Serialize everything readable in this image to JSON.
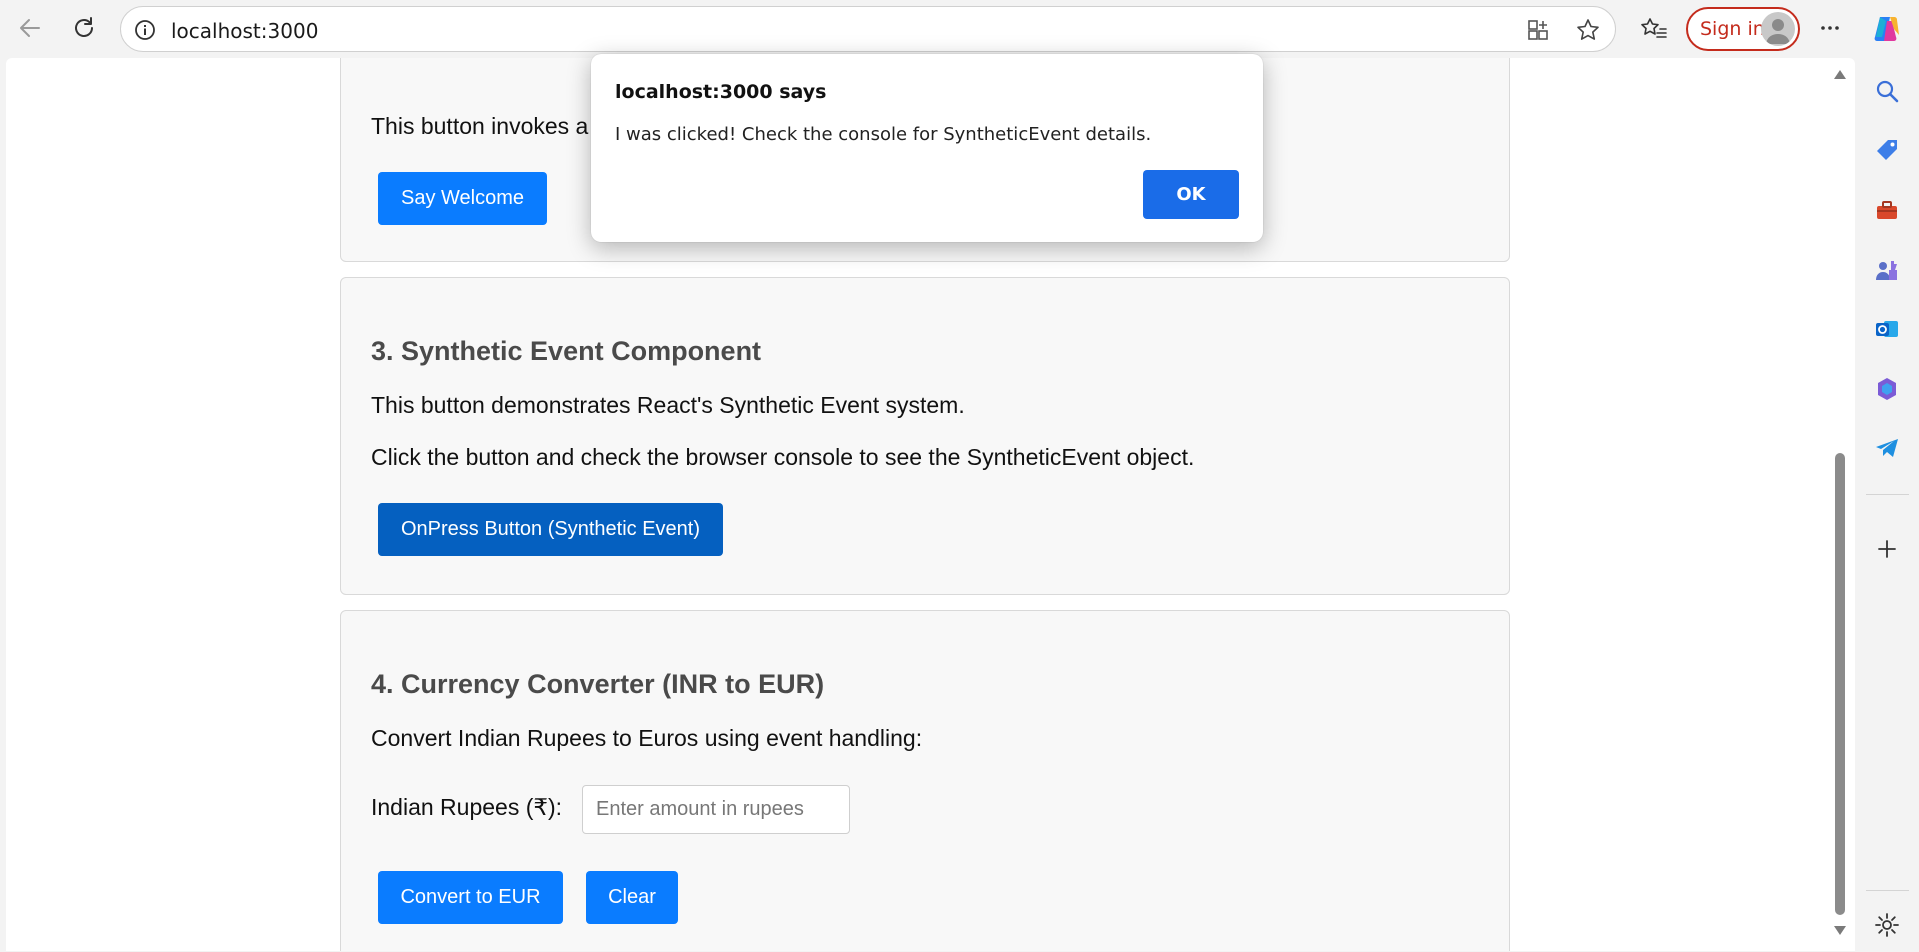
{
  "browser": {
    "url": "localhost:3000",
    "signin_label": "Sign in",
    "accent_color": "#c42b1c"
  },
  "page": {
    "card1": {
      "text": "This button invokes a",
      "button_label": "Say Welcome"
    },
    "card2": {
      "title": "3. Synthetic Event Component",
      "text1": "This button demonstrates React's Synthetic Event system.",
      "text2": "Click the button and check the browser console to see the SyntheticEvent object.",
      "button_label": "OnPress Button (Synthetic Event)"
    },
    "card3": {
      "title": "4. Currency Converter (INR to EUR)",
      "text": "Convert Indian Rupees to Euros using event handling:",
      "input_label": "Indian Rupees (₹):",
      "input_placeholder": "Enter amount in rupees",
      "input_value": "",
      "convert_label": "Convert to EUR",
      "clear_label": "Clear"
    },
    "button_color": "#0a7cff"
  },
  "dialog": {
    "title": "localhost:3000 says",
    "message": "I was clicked! Check the console for SyntheticEvent details.",
    "ok_label": "OK"
  },
  "sidebar": {
    "icons": [
      "search-icon",
      "shopping-tag-icon",
      "toolbox-icon",
      "games-icon",
      "outlook-icon",
      "m365-icon",
      "telegram-icon",
      "add-icon",
      "settings-icon"
    ]
  }
}
